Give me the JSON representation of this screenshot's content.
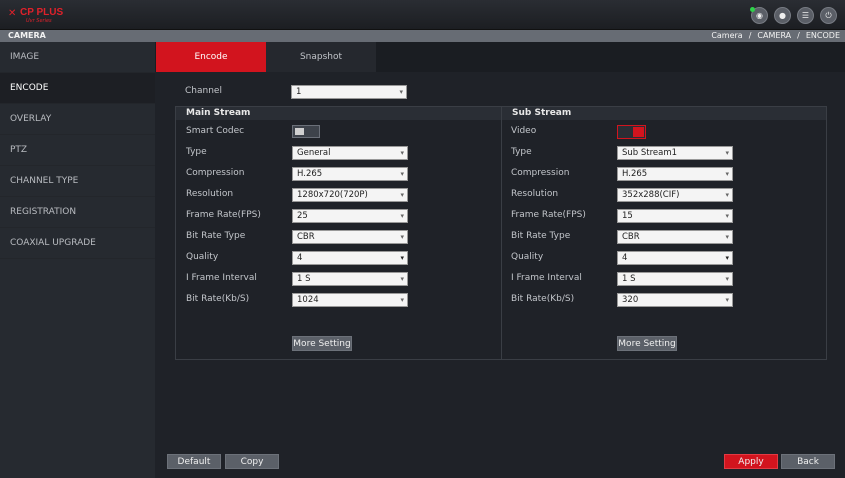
{
  "header": {
    "logo_brand": "CP PLUS",
    "logo_sub": "Uvr Series",
    "icons": [
      "eye-icon",
      "user-icon",
      "menu-icon",
      "power-icon"
    ]
  },
  "titlebar": {
    "title": "CAMERA",
    "breadcrumb": [
      "Camera",
      "CAMERA",
      "ENCODE"
    ],
    "sep": "/"
  },
  "sidebar": {
    "items": [
      {
        "label": "IMAGE"
      },
      {
        "label": "ENCODE"
      },
      {
        "label": "OVERLAY"
      },
      {
        "label": "PTZ"
      },
      {
        "label": "CHANNEL TYPE"
      },
      {
        "label": "REGISTRATION"
      },
      {
        "label": "COAXIAL UPGRADE"
      }
    ],
    "active_index": 1
  },
  "tabs": [
    {
      "label": "Encode",
      "active": true
    },
    {
      "label": "Snapshot",
      "active": false
    }
  ],
  "channel": {
    "label": "Channel",
    "value": "1"
  },
  "main_stream": {
    "title": "Main Stream",
    "smart_codec_label": "Smart Codec",
    "smart_codec_on": false,
    "type_label": "Type",
    "type_value": "General",
    "compression_label": "Compression",
    "compression_value": "H.265",
    "resolution_label": "Resolution",
    "resolution_value": "1280x720(720P)",
    "fps_label": "Frame Rate(FPS)",
    "fps_value": "25",
    "brt_label": "Bit Rate Type",
    "brt_value": "CBR",
    "quality_label": "Quality",
    "quality_value": "4",
    "iframe_label": "I Frame Interval",
    "iframe_value": "1 S",
    "bitrate_label": "Bit Rate(Kb/S)",
    "bitrate_value": "1024",
    "more_label": "More Setting"
  },
  "sub_stream": {
    "title": "Sub Stream",
    "video_label": "Video",
    "video_on": true,
    "type_label": "Type",
    "type_value": "Sub Stream1",
    "compression_label": "Compression",
    "compression_value": "H.265",
    "resolution_label": "Resolution",
    "resolution_value": "352x288(CIF)",
    "fps_label": "Frame Rate(FPS)",
    "fps_value": "15",
    "brt_label": "Bit Rate Type",
    "brt_value": "CBR",
    "quality_label": "Quality",
    "quality_value": "4",
    "iframe_label": "I Frame Interval",
    "iframe_value": "1 S",
    "bitrate_label": "Bit Rate(Kb/S)",
    "bitrate_value": "320",
    "more_label": "More Setting"
  },
  "footer": {
    "default_label": "Default",
    "copy_label": "Copy",
    "apply_label": "Apply",
    "back_label": "Back"
  },
  "colors": {
    "accent": "#d2141e",
    "status_dot": "#2fd24a"
  }
}
